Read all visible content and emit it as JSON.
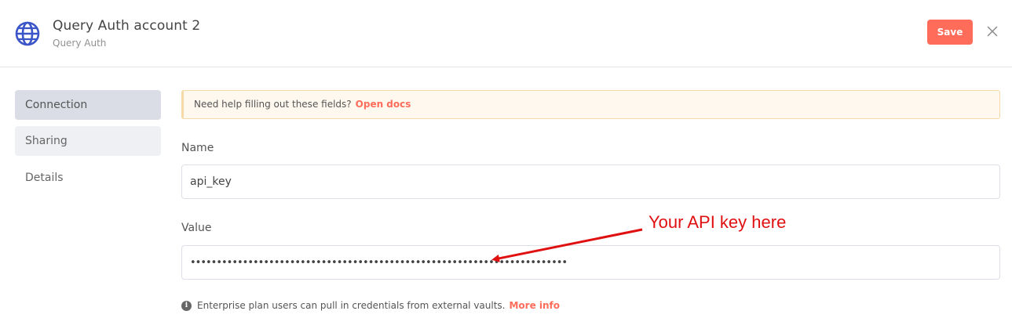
{
  "header": {
    "title": "Query Auth account 2",
    "subtitle": "Query Auth",
    "save_label": "Save",
    "icon": "globe-icon",
    "close_icon": "close-icon"
  },
  "sidebar": {
    "items": [
      {
        "label": "Connection",
        "active": true
      },
      {
        "label": "Sharing",
        "active": false
      },
      {
        "label": "Details",
        "active": false
      }
    ]
  },
  "banner": {
    "text": "Need help filling out these fields?",
    "link": "Open docs"
  },
  "fields": {
    "name": {
      "label": "Name",
      "value": "api_key"
    },
    "value": {
      "label": "Value",
      "value": "••••••••••••••••••••••••••••••••••••••••••••••••••••••••••••••••••••••••"
    }
  },
  "hint": {
    "text": "Enterprise plan users can pull in credentials from external vaults.",
    "link": "More info"
  },
  "annotation": {
    "text": "Your API key here",
    "color": "#e01010"
  },
  "colors": {
    "accent": "#ff6d5a",
    "globe": "#3b55c9"
  }
}
